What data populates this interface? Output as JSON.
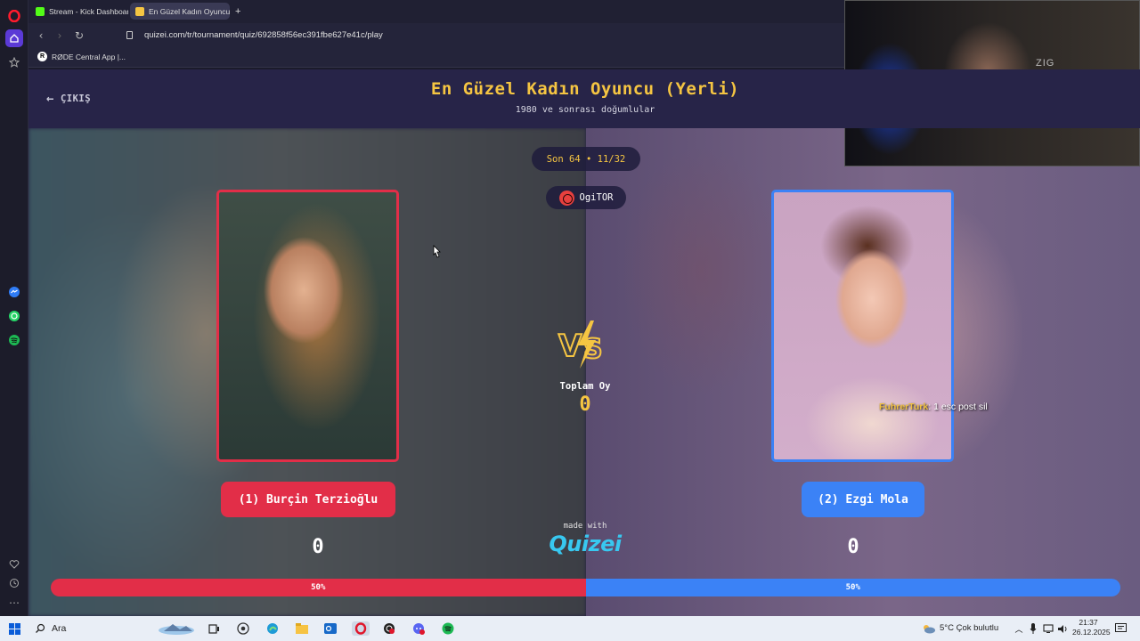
{
  "browser": {
    "tabs": [
      {
        "label": "Stream - Kick Dashboard",
        "icon": "kick-icon",
        "active": false
      },
      {
        "label": "En Güzel Kadın Oyuncu (Y",
        "icon": "quizei-favicon",
        "active": true
      }
    ],
    "new_tab": "+",
    "url": "quizei.com/tr/tournament/quiz/692858f56ec391fbe627e41c/play",
    "bookmark": "RØDE Central App |..."
  },
  "page": {
    "exit_label": "ÇIKIŞ",
    "title": "En Güzel Kadın Oyuncu (Yerli)",
    "subtitle": "1980 ve sonrası doğumlular",
    "round_label": "Son 64 • 11/32",
    "username": "OgiTOR",
    "total_votes_label": "Toplam Oy",
    "total_votes": "0",
    "made_with": "made with",
    "brand": "Quizei",
    "contestants": [
      {
        "name": "(1) Burçin Terzioğlu",
        "votes": "0",
        "percent": "50%",
        "color": "#e22e48"
      },
      {
        "name": "(2) Ezgi Mola",
        "votes": "0",
        "percent": "50%",
        "color": "#3b82f6"
      }
    ],
    "split_fraction": 0.5
  },
  "overlay": {
    "chat_user": "FuhrerTurk",
    "chat_message": ": 1 esc post sil",
    "webcam_text": "ZIG"
  },
  "taskbar": {
    "search": "Ara",
    "weather": "5°C  Çok bulutlu",
    "time": "21:37",
    "date": "26.12.2025"
  }
}
